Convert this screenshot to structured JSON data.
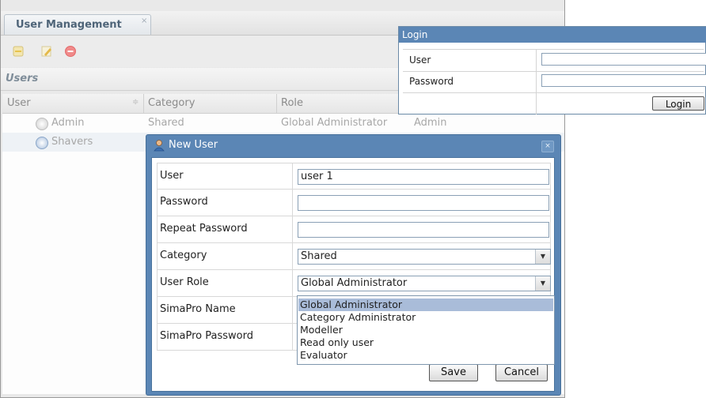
{
  "main": {
    "tab_label": "User Management",
    "tab_close": "×",
    "toolbar": {
      "icons": [
        "add-icon",
        "edit-icon",
        "delete-icon"
      ]
    },
    "panel_title": "Users",
    "grid": {
      "columns": [
        "User",
        "Category",
        "Role"
      ],
      "rows": [
        {
          "user": "Admin",
          "category": "Shared",
          "role": "Global Administrator",
          "simapro": "Admin"
        },
        {
          "user": "Shavers",
          "category": "",
          "role": "",
          "simapro": ""
        }
      ]
    }
  },
  "login": {
    "title": "Login",
    "user_label": "User",
    "password_label": "Password",
    "user_value": "",
    "password_value": "",
    "button_label": "Login"
  },
  "new_user": {
    "title": "New User",
    "close": "×",
    "fields": {
      "user": {
        "label": "User",
        "value": "user 1"
      },
      "password": {
        "label": "Password",
        "value": ""
      },
      "repeat_password": {
        "label": "Repeat Password",
        "value": ""
      },
      "category": {
        "label": "Category",
        "value": "Shared"
      },
      "user_role": {
        "label": "User Role",
        "value": "Global Administrator"
      },
      "simapro_name": {
        "label": "SimaPro Name",
        "value": ""
      },
      "simapro_password": {
        "label": "SimaPro Password",
        "value": ""
      }
    },
    "role_options": [
      "Global Administrator",
      "Category Administrator",
      "Modeller",
      "Read only user",
      "Evaluator"
    ],
    "selected_role_index": 0,
    "save_label": "Save",
    "cancel_label": "Cancel"
  },
  "colors": {
    "dialog_header": "#5b86b5",
    "selected_option": "#a9bcd9",
    "tab_text": "#4e6478"
  }
}
